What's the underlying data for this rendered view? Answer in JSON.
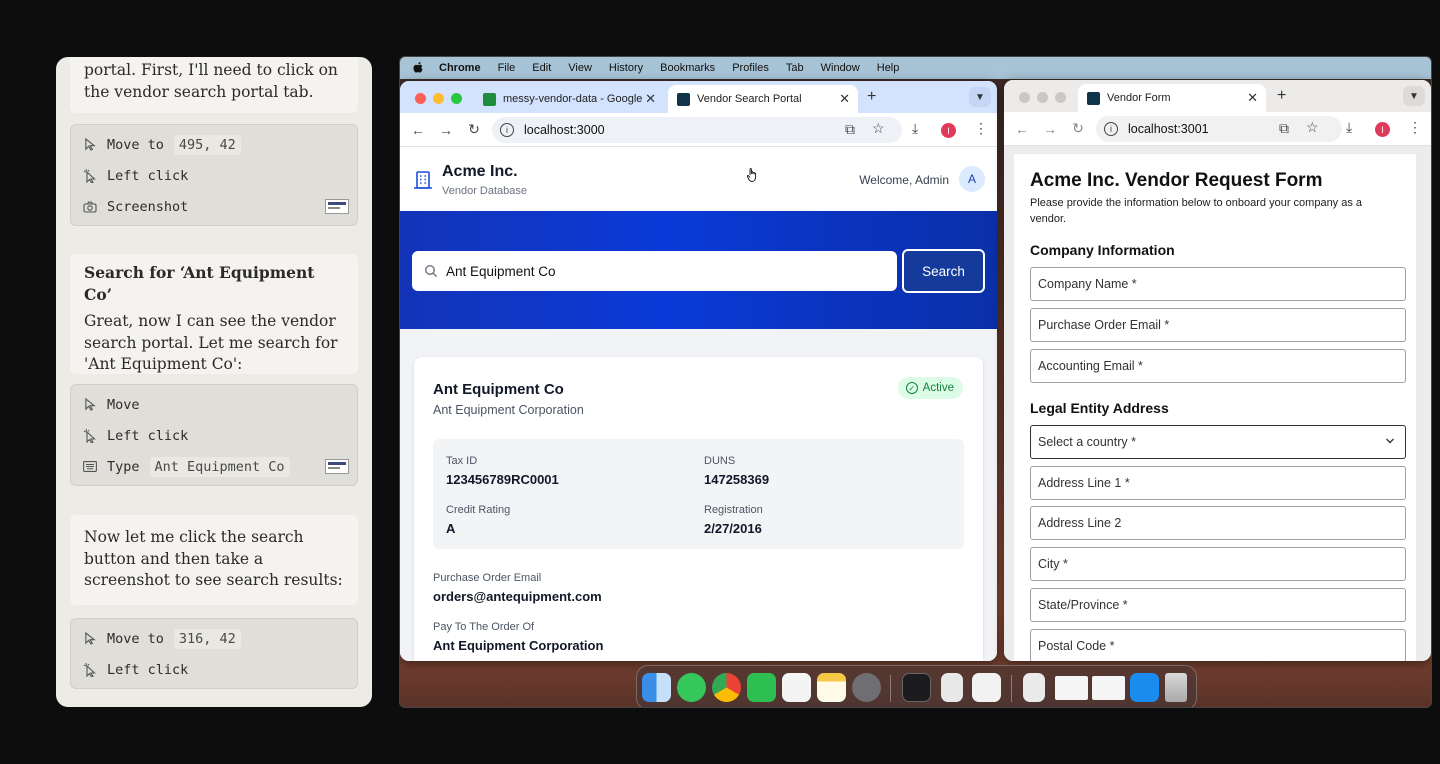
{
  "log": {
    "msg1": "portal. First, I'll need to click on the vendor search portal tab.",
    "group1": [
      {
        "icon": "pointer-icon",
        "label": "Move to",
        "arg": "495, 42"
      },
      {
        "icon": "click-icon",
        "label": "Left click",
        "arg": ""
      },
      {
        "icon": "camera-icon",
        "label": "Screenshot",
        "arg": ""
      }
    ],
    "msg2_title": "Search for ‘Ant Equipment Co’",
    "msg2": "Great, now I can see the vendor search portal. Let me search for 'Ant Equipment Co':",
    "group2": [
      {
        "icon": "pointer-icon",
        "label": "Move",
        "arg": ""
      },
      {
        "icon": "click-icon",
        "label": "Left click",
        "arg": ""
      },
      {
        "icon": "keyboard-icon",
        "label": "Type",
        "arg": "Ant Equipment Co"
      }
    ],
    "msg3": "Now let me click the search button and then take a screenshot to see search results:",
    "group3": [
      {
        "icon": "pointer-icon",
        "label": "Move to",
        "arg": "316, 42"
      },
      {
        "icon": "click-icon",
        "label": "Left click",
        "arg": ""
      }
    ]
  },
  "menubar": {
    "app": "Chrome",
    "items": [
      "File",
      "Edit",
      "View",
      "History",
      "Bookmarks",
      "Profiles",
      "Tab",
      "Window",
      "Help"
    ]
  },
  "browser1": {
    "tabs": [
      {
        "title": "messy-vendor-data - Google",
        "color": "#1e8e3e"
      },
      {
        "title": "Vendor Search Portal",
        "color": "#10344a"
      }
    ],
    "url": "localhost:3000",
    "profile_initial": "I"
  },
  "portal": {
    "company": "Acme Inc.",
    "subtitle": "Vendor Database",
    "welcome": "Welcome, Admin",
    "avatar": "A",
    "search_value": "Ant Equipment Co",
    "search_button": "Search",
    "result": {
      "name": "Ant Equipment Co",
      "legal_name": "Ant Equipment Corporation",
      "status": "Active",
      "tax_id_label": "Tax ID",
      "tax_id": "123456789RC0001",
      "duns_label": "DUNS",
      "duns": "147258369",
      "credit_label": "Credit Rating",
      "credit": "A",
      "reg_label": "Registration",
      "registration": "2/27/2016",
      "po_email_label": "Purchase Order Email",
      "po_email": "orders@antequipment.com",
      "pay_to_label": "Pay To The Order Of",
      "pay_to": "Ant Equipment Corporation"
    }
  },
  "browser2": {
    "tab_title": "Vendor Form",
    "url": "localhost:3001",
    "profile_initial": "I"
  },
  "form": {
    "title": "Acme Inc. Vendor Request Form",
    "description": "Please provide the information below to onboard your company as a vendor.",
    "section1": "Company Information",
    "company_name": "Company Name *",
    "po_email": "Purchase Order Email *",
    "accounting_email": "Accounting Email *",
    "section2": "Legal Entity Address",
    "country": "Select a country *",
    "address1": "Address Line 1 *",
    "address2": "Address Line 2",
    "city": "City *",
    "state": "State/Province *",
    "postal": "Postal Code *"
  },
  "colors": {
    "hero_blue": "#0a3ad8",
    "active_green": "#15803d",
    "profile_red": "#e03a5a"
  }
}
